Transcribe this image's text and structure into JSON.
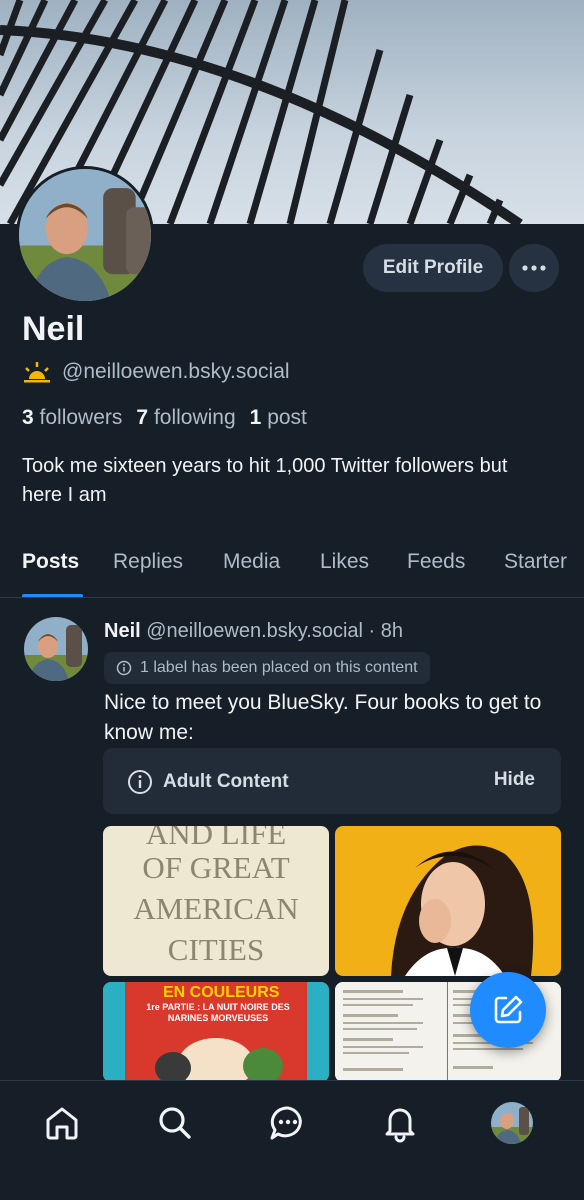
{
  "profile": {
    "display_name": "Neil",
    "handle": "@neilloewen.bsky.social",
    "edit_label": "Edit Profile",
    "followers_count": "3",
    "followers_label": "followers",
    "following_count": "7",
    "following_label": "following",
    "posts_count": "1",
    "posts_label": "post",
    "bio": "Took me sixteen years to hit 1,000 Twitter followers but here I am"
  },
  "tabs": [
    "Posts",
    "Replies",
    "Media",
    "Likes",
    "Feeds",
    "Starter"
  ],
  "active_tab": "Posts",
  "post": {
    "author": "Neil",
    "handle": "@neilloewen.bsky.social",
    "separator": "·",
    "time": "8h",
    "label_notice": "1 label has been placed on this content",
    "text": "Nice to meet you BlueSky. Four books to get to know me:",
    "content_warning": "Adult Content",
    "hide_label": "Hide",
    "book1_lines": [
      "AND LIFE",
      "OF GREAT",
      "AMERICAN",
      "CITIES"
    ],
    "book3_title": "EN COULEURS",
    "book3_subtitle": "1re PARTIE : LA NUIT NOIRE DES NARINES MORVEUSES"
  },
  "nav": [
    "home-icon",
    "search-icon",
    "chat-icon",
    "bell-icon",
    "profile-avatar"
  ],
  "colors": {
    "background": "#161e27",
    "accent": "#208bfe",
    "muted_text": "#aebbc9",
    "button_bg": "#263241"
  }
}
